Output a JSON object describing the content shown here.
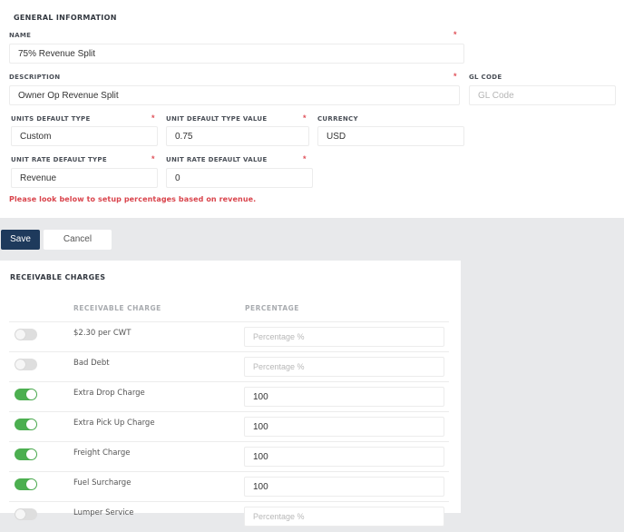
{
  "general": {
    "section_title": "GENERAL INFORMATION",
    "required_marker": "*",
    "name": {
      "label": "NAME",
      "value": "75% Revenue Split"
    },
    "description": {
      "label": "DESCRIPTION",
      "value": "Owner Op Revenue Split"
    },
    "gl_code": {
      "label": "GL CODE",
      "value": "",
      "placeholder": "GL Code"
    },
    "units_default_type": {
      "label": "UNITS DEFAULT TYPE",
      "value": "Custom"
    },
    "unit_default_type_value": {
      "label": "UNIT DEFAULT TYPE VALUE",
      "value": "0.75"
    },
    "currency": {
      "label": "CURRENCY",
      "value": "USD"
    },
    "unit_rate_default_type": {
      "label": "UNIT RATE DEFAULT TYPE",
      "value": "Revenue"
    },
    "unit_rate_default_value": {
      "label": "UNIT RATE DEFAULT VALUE",
      "value": "0"
    },
    "hint": "Please look below to setup percentages based on revenue."
  },
  "actions": {
    "save_label": "Save",
    "cancel_label": "Cancel"
  },
  "receivable": {
    "section_title": "RECEIVABLE CHARGES",
    "columns": {
      "charge": "RECEIVABLE CHARGE",
      "percentage": "PERCENTAGE"
    },
    "percentage_placeholder": "Percentage %",
    "rows": [
      {
        "name": "$2.30 per CWT",
        "enabled": false,
        "percentage": ""
      },
      {
        "name": "Bad Debt",
        "enabled": false,
        "percentage": ""
      },
      {
        "name": "Extra Drop Charge",
        "enabled": true,
        "percentage": "100"
      },
      {
        "name": "Extra Pick Up Charge",
        "enabled": true,
        "percentage": "100"
      },
      {
        "name": "Freight Charge",
        "enabled": true,
        "percentage": "100"
      },
      {
        "name": "Fuel Surcharge",
        "enabled": true,
        "percentage": "100"
      },
      {
        "name": "Lumper Service",
        "enabled": false,
        "percentage": ""
      }
    ]
  },
  "colors": {
    "primary": "#1e3a5c",
    "toggle_on": "#4caf50",
    "required": "#e0525a",
    "hint": "#d9434b",
    "background": "#e8e9eb"
  }
}
